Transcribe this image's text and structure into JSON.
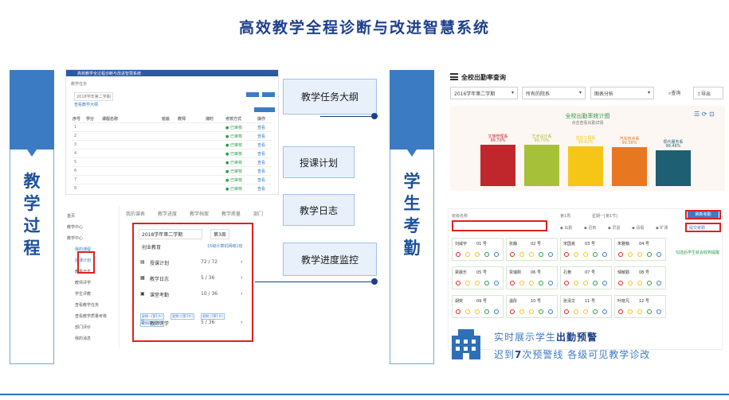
{
  "title": "高效教学全程诊断与改进智慧系统",
  "left_label": "教学过程",
  "right_label": "学生考勤",
  "callouts": [
    "教学任务大纲",
    "授课计划",
    "教学日志",
    "教学进度监控"
  ],
  "left_top_shot": {
    "header": "高校教学全过程诊断与改进智慧系统",
    "crumb": "教学任务",
    "filter_term": "2018学年第二学期",
    "link_text": "查看教学大纲",
    "columns": [
      "序号",
      "学分",
      "课程名称",
      "班级",
      "教师",
      "课时",
      "考核方式",
      "操作"
    ],
    "status_label": "已审核"
  },
  "left_bottom_shot": {
    "tabs": [
      "我的课表",
      "教学进度",
      "教学档案",
      "教学质量",
      "部门"
    ],
    "sidebar": [
      "首页",
      "教学中心",
      "教学中心",
      "我的课程",
      "授课计划",
      "教学日志",
      "教师评学",
      "学生评教",
      "查看教学任务",
      "查看教学质量考核",
      "部门评价",
      "我的消息"
    ],
    "term": "2018学年第二学期",
    "week": "第3周",
    "course": "创业教育",
    "class_link": "15级计算机网络1班",
    "rows": [
      {
        "label": "授课计划",
        "value": "72 / 72"
      },
      {
        "label": "教学日志",
        "value": "5 / 36"
      },
      {
        "label": "课堂考勤",
        "value": "10 / 36"
      },
      {
        "label": "教师评学",
        "value": "5 / 36"
      }
    ],
    "tags": [
      "星期一[第1节]",
      "星期二[第3节]",
      "星期三[第1节]",
      "星期四[第3节]"
    ]
  },
  "right_top": {
    "title": "全校出勤率查询",
    "term": "2016学年第二学期",
    "dept": "所有的院系",
    "view": "图表分析",
    "query": "查询",
    "export": "导出",
    "chart_title": "全校出勤率统计图",
    "chart_subtitle": "点击查看出勤详情"
  },
  "chart_data": {
    "type": "bar",
    "title": "全校出勤率统计图",
    "categories": [
      "文旅管理系",
      "艺术设计系",
      "信息工程系",
      "汽车技术系",
      "现代服务系"
    ],
    "values": [
      99.7,
      99.7,
      99.62,
      99.58,
      99.46
    ],
    "value_labels": [
      "99.70%",
      "99.70%",
      "99.62%",
      "99.58%",
      "99.46%"
    ],
    "colors": [
      "#c0272d",
      "#a7c03a",
      "#f5c518",
      "#e87722",
      "#1f5f73"
    ]
  },
  "right_bottom": {
    "class_label": "班级名称",
    "term_label": "第1周",
    "weekday": "星期一[第1节]",
    "btn_label": "刷新考勤",
    "btn2_label": "提交考勤",
    "legend": [
      "出勤",
      "迟到",
      "早退",
      "请假",
      "旷课"
    ],
    "note": "勾选后学生就会收到提醒",
    "students": [
      {
        "name": "刘威宇",
        "no": "01 号"
      },
      {
        "name": "张静",
        "no": "02 号"
      },
      {
        "name": "宋国良",
        "no": "03 号"
      },
      {
        "name": "朱雅萌",
        "no": "04 号"
      },
      {
        "name": "梁晨乐",
        "no": "05 号"
      },
      {
        "name": "贾瑞刚",
        "no": "06 号"
      },
      {
        "name": "孔艳",
        "no": "07 号"
      },
      {
        "name": "邹敏勤",
        "no": "08 号"
      },
      {
        "name": "胡荧",
        "no": "09 号"
      },
      {
        "name": "温彤",
        "no": "10 号"
      },
      {
        "name": "张清文",
        "no": "11 号"
      },
      {
        "name": "叶晓凡",
        "no": "12 号"
      }
    ]
  },
  "warn_line1_pre": "实时展示学生",
  "warn_line1_bold": "出勤预警",
  "warn_line2_pre": "迟到",
  "warn_line2_bold": "7",
  "warn_line2_post": "次预警线   各级可见教学诊改"
}
